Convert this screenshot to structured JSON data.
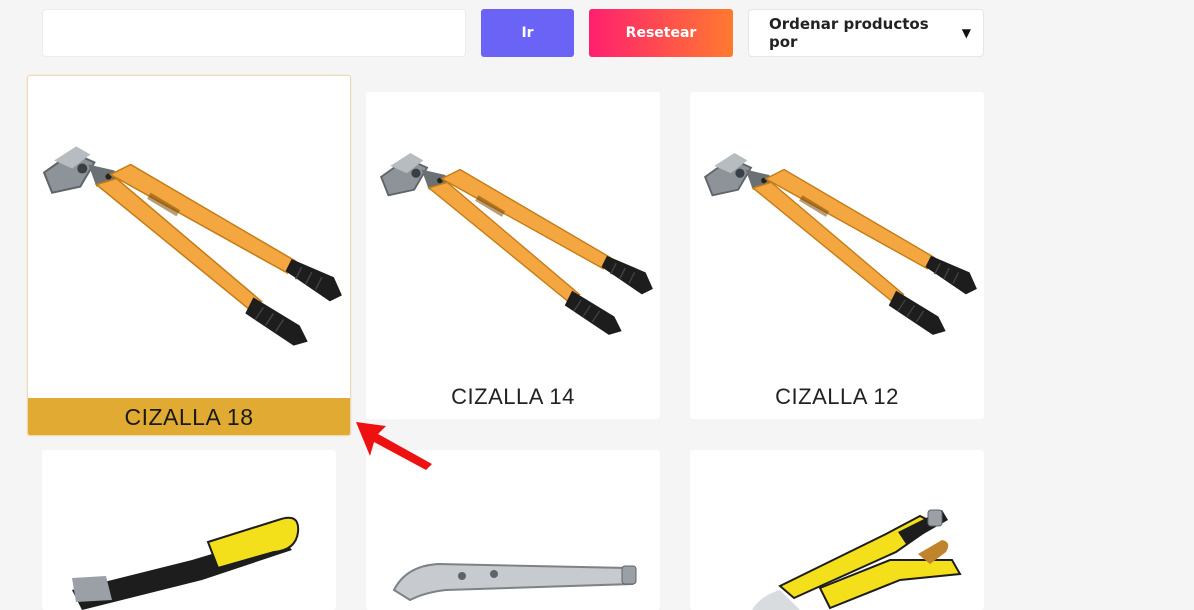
{
  "toolbar": {
    "search_value": "",
    "go_label": "Ir",
    "reset_label": "Resetear",
    "sort_selected": "Ordenar productos por"
  },
  "products": [
    {
      "name": "CIZALLA 18",
      "image": "bolt-cutter",
      "highlighted": true
    },
    {
      "name": "CIZALLA 14",
      "image": "bolt-cutter"
    },
    {
      "name": "CIZALLA 12",
      "image": "bolt-cutter"
    },
    {
      "name": "",
      "image": "yellow-handle-tool"
    },
    {
      "name": "",
      "image": "locking-pliers"
    },
    {
      "name": "",
      "image": "yellow-pliers"
    }
  ],
  "colors": {
    "go_button": "#6a63f6",
    "reset_gradient_start": "#ff1f6f",
    "reset_gradient_end": "#ff7a2f",
    "highlight_bar": "#e0aa33",
    "annotation_arrow": "#ee1111",
    "tool_orange": "#f4a640",
    "tool_yellow": "#f3e01a"
  },
  "annotation": {
    "icon": "red-arrow-pointer"
  }
}
